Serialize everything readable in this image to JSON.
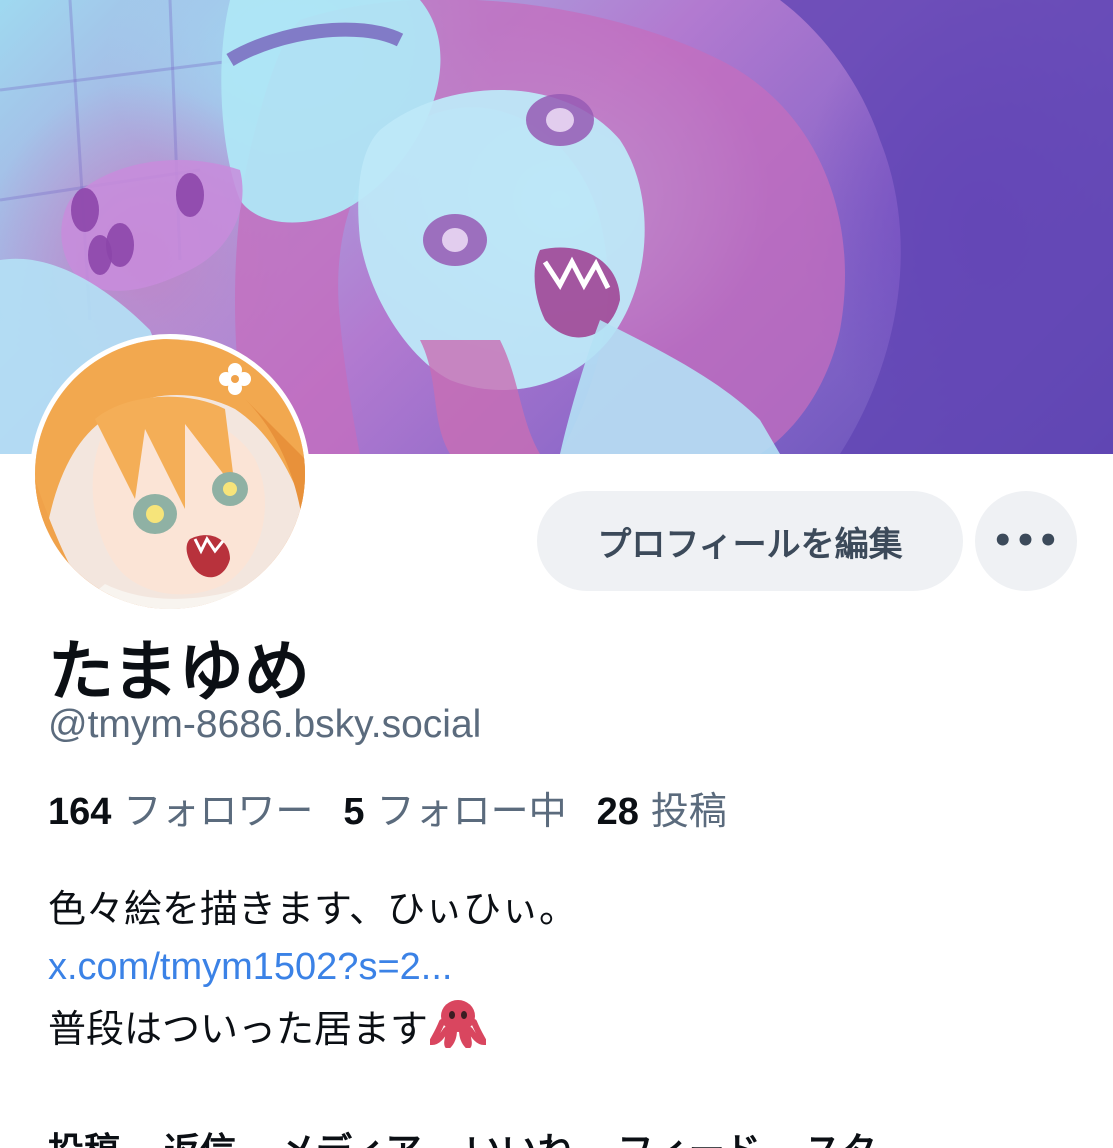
{
  "profile": {
    "display_name": "たまゆめ",
    "handle": "@tmym-8686.bsky.social",
    "edit_button_label": "プロフィールを編集",
    "more_button_label": "•••"
  },
  "stats": [
    {
      "count": "164",
      "label": "フォロワー"
    },
    {
      "count": "5",
      "label": "フォロー中"
    },
    {
      "count": "28",
      "label": "投稿"
    }
  ],
  "bio": {
    "line1": "色々絵を描きます、ひぃひぃ。",
    "link": "x.com/tmym1502?s=2...",
    "line3": "普段はついった居ます"
  },
  "tabs": [
    "投稿",
    "返信",
    "メディア",
    "いいね",
    "フィード",
    "スタ"
  ],
  "colors": {
    "link": "#3b82e6",
    "button_bg": "#eff1f4",
    "secondary_text": "#5b6b7d"
  },
  "icons": [
    "more-icon",
    "octopus-emoji"
  ]
}
